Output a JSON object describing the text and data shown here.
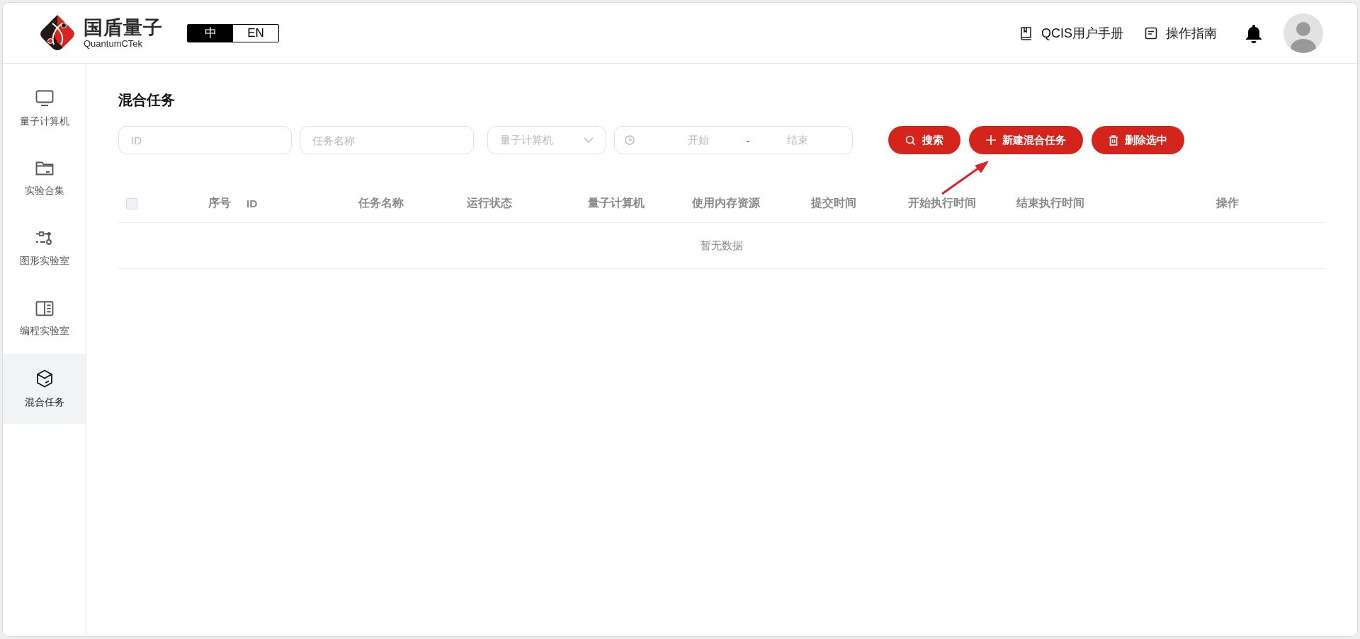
{
  "header": {
    "logo": {
      "name": "国盾量子",
      "subtitle": "QuantumCTek"
    },
    "languages": [
      {
        "label": "中",
        "selected": true
      },
      {
        "label": "EN",
        "selected": false
      }
    ],
    "links": [
      {
        "label": "QCIS用户手册",
        "kind": "book"
      },
      {
        "label": "操作指南",
        "kind": "document"
      }
    ]
  },
  "sidebar": {
    "items": [
      {
        "label": "量子计算机",
        "kind": "monitor",
        "selected": false
      },
      {
        "label": "实验合集",
        "kind": "folder",
        "selected": false
      },
      {
        "label": "图形实验室",
        "kind": "circuit",
        "selected": false
      },
      {
        "label": "编程实验室",
        "kind": "panel",
        "selected": false
      },
      {
        "label": "混合任务",
        "kind": "cube",
        "selected": true
      }
    ]
  },
  "page": {
    "title": "混合任务",
    "filters": {
      "id": {
        "placeholder": "ID"
      },
      "task_name": {
        "placeholder": "任务名称"
      },
      "computer": {
        "placeholder": "量子计算机"
      },
      "date_range": {
        "start_placeholder": "开始",
        "separator": "-",
        "end_placeholder": "结束"
      }
    },
    "buttons": [
      {
        "label": "搜索",
        "kind": "search"
      },
      {
        "label": "新建混合任务",
        "kind": "add"
      },
      {
        "label": "删除选中",
        "kind": "delete"
      }
    ],
    "table": {
      "select_all": {
        "checked": false
      },
      "columns": [
        "序号",
        "ID",
        "任务名称",
        "运行状态",
        "量子计算机",
        "使用内存资源",
        "提交时间",
        "开始执行时间",
        "结束执行时间",
        "操作"
      ],
      "empty_text": "暂无数据"
    }
  }
}
